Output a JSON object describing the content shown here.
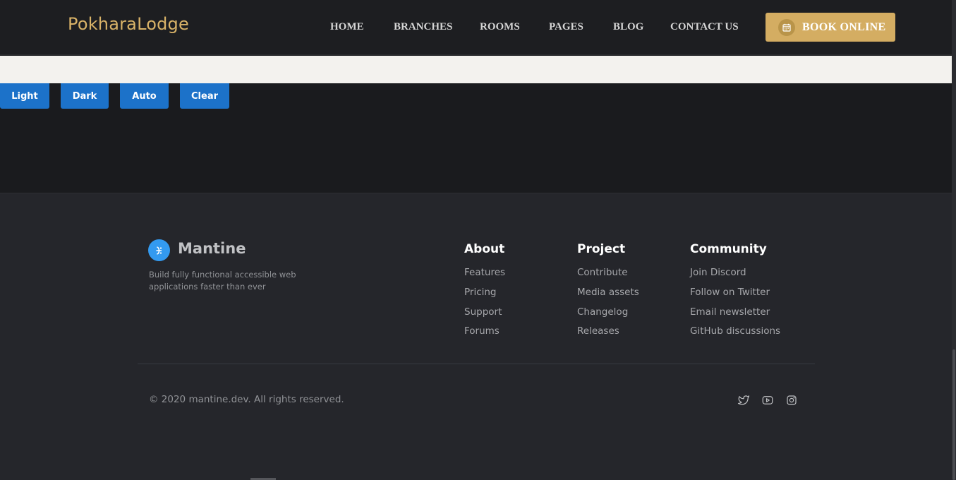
{
  "header": {
    "logo": "PokharaLodge",
    "nav": [
      "HOME",
      "BRANCHES",
      "ROOMS",
      "PAGES",
      "BLOG",
      "CONTACT US"
    ],
    "book_label": "BOOK ONLINE",
    "book_icon": "calendar-icon"
  },
  "theme_buttons": [
    "Light",
    "Dark",
    "Auto",
    "Clear"
  ],
  "footer": {
    "brand": "Mantine",
    "tagline": "Build fully functional accessible web applications faster than ever",
    "columns": [
      {
        "title": "About",
        "links": [
          "Features",
          "Pricing",
          "Support",
          "Forums"
        ]
      },
      {
        "title": "Project",
        "links": [
          "Contribute",
          "Media assets",
          "Changelog",
          "Releases"
        ]
      },
      {
        "title": "Community",
        "links": [
          "Join Discord",
          "Follow on Twitter",
          "Email newsletter",
          "GitHub discussions"
        ]
      }
    ],
    "copyright": "© 2020 mantine.dev. All rights reserved.",
    "social_icons": [
      "twitter-icon",
      "youtube-icon",
      "instagram-icon"
    ]
  },
  "colors": {
    "accent_gold": "#d4ad62",
    "theme_button_blue": "#1c72c9",
    "mantine_blue": "#339af0"
  }
}
